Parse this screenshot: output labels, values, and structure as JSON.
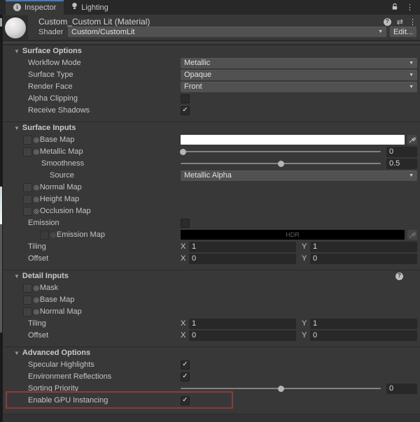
{
  "icons": {
    "check": "✓",
    "dropdown_arrow": "▼",
    "foldout": "▼",
    "kebab": "⋮",
    "presets": "⇄",
    "info": "i",
    "help": "?",
    "target": "◎"
  },
  "tab_bar": {
    "inspector": "Inspector",
    "lighting": "Lighting"
  },
  "header": {
    "title": "Custom_Custom Lit (Material)",
    "shader_label": "Shader",
    "shader_value": "Custom/CustomLit",
    "edit_button": "Edit..."
  },
  "surface_options": {
    "title": "Surface Options",
    "workflow_mode_label": "Workflow Mode",
    "workflow_mode_value": "Metallic",
    "surface_type_label": "Surface Type",
    "surface_type_value": "Opaque",
    "render_face_label": "Render Face",
    "render_face_value": "Front",
    "alpha_clipping_label": "Alpha Clipping",
    "receive_shadows_label": "Receive Shadows"
  },
  "surface_inputs": {
    "title": "Surface Inputs",
    "base_map_label": "Base Map",
    "metallic_map_label": "Metallic Map",
    "metallic_map_value": "0",
    "smoothness_label": "Smoothness",
    "smoothness_value": "0.5",
    "source_label": "Source",
    "source_value": "Metallic Alpha",
    "normal_map_label": "Normal Map",
    "height_map_label": "Height Map",
    "occlusion_map_label": "Occlusion Map",
    "emission_label": "Emission",
    "emission_map_label": "Emission Map",
    "hdr_label": "HDR",
    "tiling_label": "Tiling",
    "tiling_x": "1",
    "tiling_y": "1",
    "offset_label": "Offset",
    "offset_x": "0",
    "offset_y": "0",
    "x_label": "X",
    "y_label": "Y"
  },
  "detail_inputs": {
    "title": "Detail Inputs",
    "mask_label": "Mask",
    "base_map_label": "Base Map",
    "normal_map_label": "Normal Map",
    "tiling_label": "Tiling",
    "tiling_x": "1",
    "tiling_y": "1",
    "offset_label": "Offset",
    "offset_x": "0",
    "offset_y": "0",
    "x_label": "X",
    "y_label": "Y"
  },
  "advanced_options": {
    "title": "Advanced Options",
    "specular_highlights_label": "Specular Highlights",
    "environment_reflections_label": "Environment Reflections",
    "sorting_priority_label": "Sorting Priority",
    "sorting_priority_value": "0",
    "gpu_instancing_label": "Enable GPU Instancing"
  },
  "colors": {
    "tab_accent": "#437bbd",
    "annotation_red": "#8e3a3a",
    "base_map_swatch": "#ffffff",
    "emission_map_swatch": "#000000"
  }
}
